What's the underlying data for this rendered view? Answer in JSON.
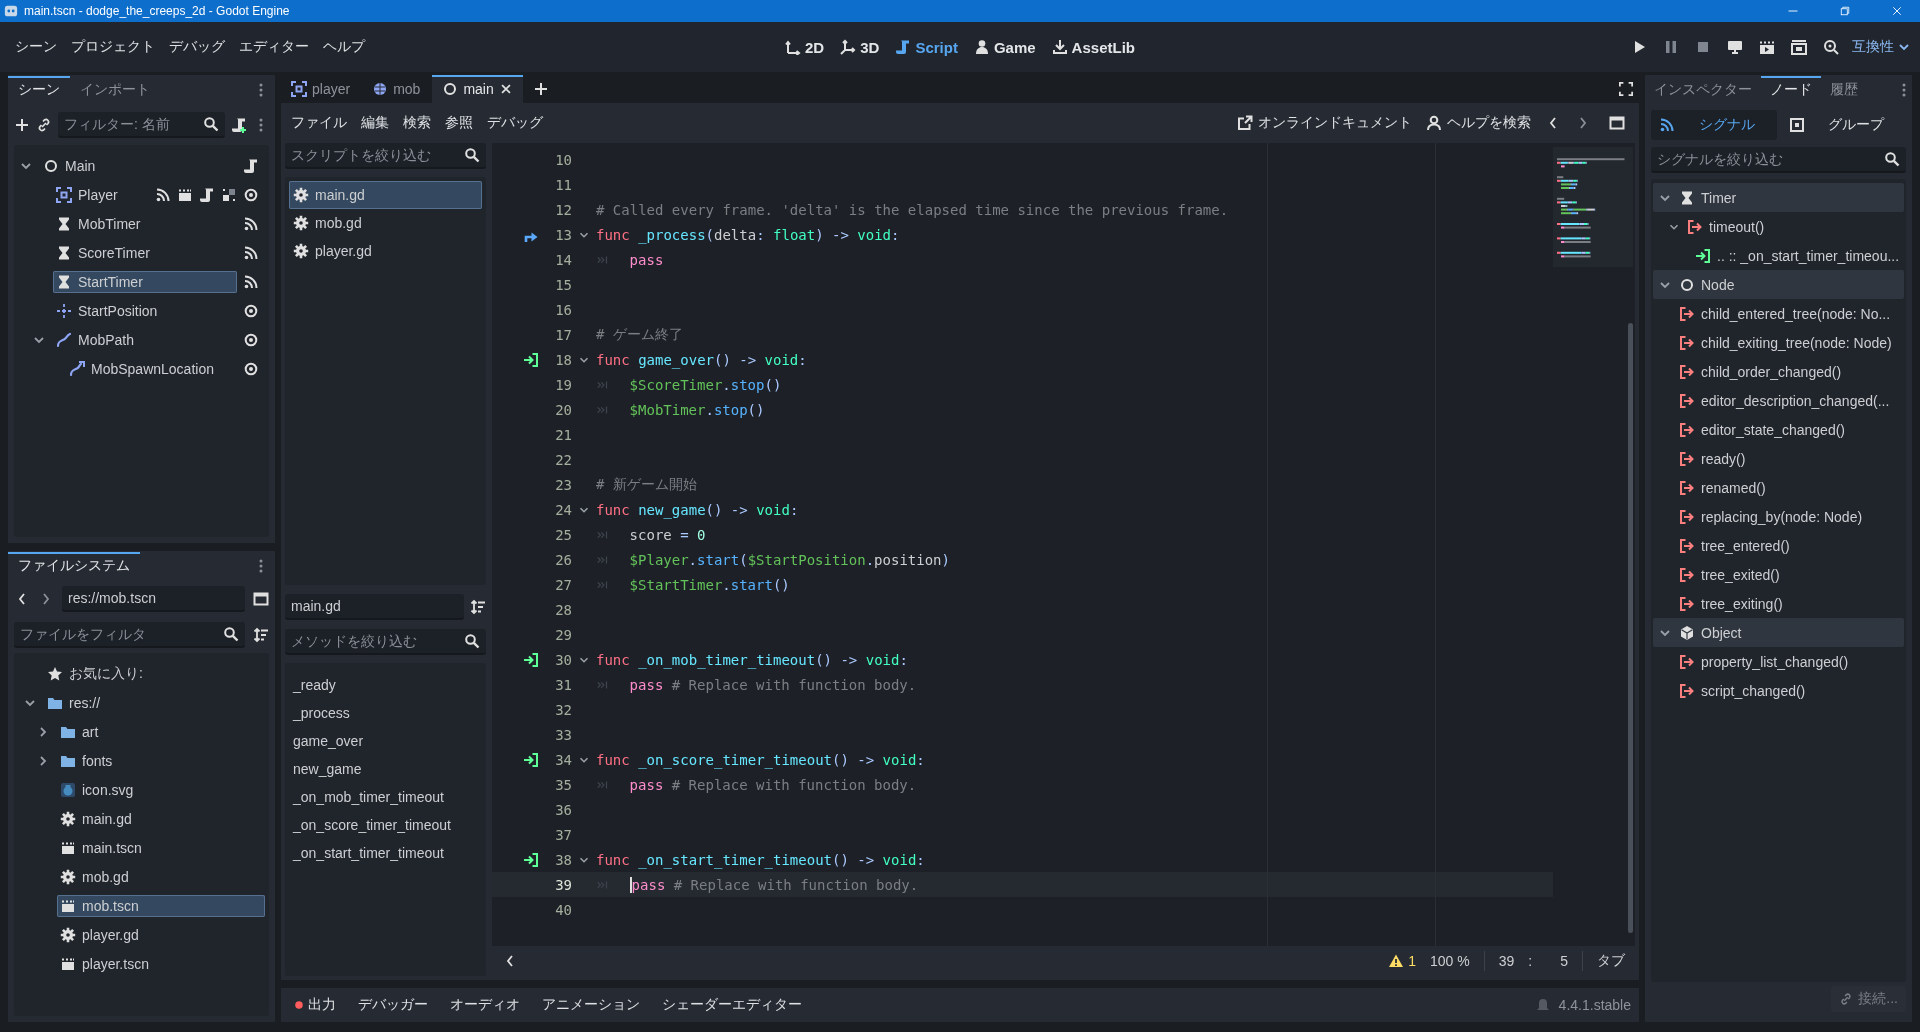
{
  "window": {
    "title": "main.tscn - dodge_the_creeps_2d - Godot Engine"
  },
  "menu": [
    "シーン",
    "プロジェクト",
    "デバッグ",
    "エディター",
    "ヘルプ"
  ],
  "workspaces": [
    {
      "label": "2D",
      "kind": "plane",
      "selected": false
    },
    {
      "label": "3D",
      "kind": "solid",
      "selected": false
    },
    {
      "label": "Script",
      "kind": "script",
      "selected": true
    },
    {
      "label": "Game",
      "kind": "game",
      "selected": false
    },
    {
      "label": "AssetLib",
      "kind": "assetlib",
      "selected": false
    }
  ],
  "renderer": {
    "label": "互換性"
  },
  "scene_dock": {
    "tabs": [
      {
        "label": "シーン",
        "selected": true
      },
      {
        "label": "インポート",
        "selected": false
      }
    ],
    "filter": {
      "placeholder": "フィルター: 名前"
    },
    "tree": [
      {
        "name": "Main",
        "kind": "node",
        "badges": [
          {
            "kind": "script"
          }
        ],
        "selected": false,
        "expanded": true,
        "children": [
          {
            "name": "Player",
            "kind": "area",
            "badges": [
              {
                "kind": "signal"
              },
              {
                "kind": "scene"
              },
              {
                "kind": "script"
              },
              {
                "kind": "group"
              },
              {
                "kind": "visible"
              }
            ],
            "selected": false
          },
          {
            "name": "MobTimer",
            "kind": "timer",
            "badges": [
              {
                "kind": "signal"
              }
            ],
            "selected": false
          },
          {
            "name": "ScoreTimer",
            "kind": "timer",
            "badges": [
              {
                "kind": "signal"
              }
            ],
            "selected": false
          },
          {
            "name": "StartTimer",
            "kind": "timer",
            "badges": [
              {
                "kind": "signal"
              }
            ],
            "selected": true
          },
          {
            "name": "StartPosition",
            "kind": "marker",
            "badges": [
              {
                "kind": "visible"
              }
            ],
            "selected": false
          },
          {
            "name": "MobPath",
            "kind": "path",
            "badges": [
              {
                "kind": "visible"
              }
            ],
            "selected": false,
            "expanded": true,
            "children": [
              {
                "name": "MobSpawnLocation",
                "kind": "pathfollow",
                "badges": [
                  {
                    "kind": "visible"
                  }
                ],
                "selected": false
              }
            ]
          }
        ]
      }
    ]
  },
  "filesystem_dock": {
    "tabs": [
      {
        "label": "ファイルシステム",
        "selected": true
      }
    ],
    "path": "res://mob.tscn",
    "filter": {
      "placeholder": "ファイルをフィルタ"
    },
    "tree": [
      {
        "name": "お気に入り:",
        "kind": "star",
        "selected": false
      },
      {
        "name": "res://",
        "kind": "folder",
        "selected": false,
        "expanded": true,
        "children": [
          {
            "name": "art",
            "kind": "folder",
            "selected": false,
            "expanded": false
          },
          {
            "name": "fonts",
            "kind": "folder",
            "selected": false,
            "expanded": false
          },
          {
            "name": "icon.svg",
            "kind": "image",
            "selected": false
          },
          {
            "name": "main.gd",
            "kind": "gear",
            "selected": false
          },
          {
            "name": "main.tscn",
            "kind": "scene",
            "selected": false
          },
          {
            "name": "mob.gd",
            "kind": "gear",
            "selected": false
          },
          {
            "name": "mob.tscn",
            "kind": "scene",
            "selected": true
          },
          {
            "name": "player.gd",
            "kind": "gear",
            "selected": false
          },
          {
            "name": "player.tscn",
            "kind": "scene",
            "selected": false
          }
        ]
      }
    ]
  },
  "editor_tabs": [
    {
      "label": "player",
      "kind": "area",
      "selected": false
    },
    {
      "label": "mob",
      "kind": "body",
      "selected": false
    },
    {
      "label": "main",
      "kind": "node",
      "selected": true
    }
  ],
  "script_menu": [
    "ファイル",
    "編集",
    "検索",
    "参照",
    "デバッグ"
  ],
  "help_links": [
    "オンラインドキュメント",
    "ヘルプを検索"
  ],
  "scripts_panel": {
    "filter": {
      "placeholder": "スクリプトを絞り込む"
    },
    "scripts": [
      {
        "name": "main.gd",
        "selected": true
      },
      {
        "name": "mob.gd",
        "selected": false
      },
      {
        "name": "player.gd",
        "selected": false
      }
    ],
    "current": "main.gd",
    "method_filter": {
      "placeholder": "メソッドを絞り込む"
    },
    "methods": [
      "_ready",
      "_process",
      "game_over",
      "new_game",
      "_on_mob_timer_timeout",
      "_on_score_timer_timeout",
      "_on_start_timer_timeout"
    ]
  },
  "code": {
    "lines": [
      {
        "number": "10",
        "fold": false,
        "current": false
      },
      {
        "number": "11",
        "fold": false,
        "current": false
      },
      {
        "number": "12",
        "fold": false,
        "current": false,
        "tokens": [
          {
            "text": "# Called every frame. 'delta' is the elapsed time since the previous frame.",
            "kind": "comment"
          }
        ]
      },
      {
        "number": "13",
        "fold": true,
        "current": false,
        "kind": "override",
        "tokens": [
          {
            "text": "func",
            "kind": "keyword"
          },
          {
            "text": "_process",
            "kind": "function"
          },
          {
            "text": "(",
            "kind": "symbol"
          },
          {
            "text": "delta",
            "kind": "text"
          },
          {
            "text": ":",
            "kind": "symbol"
          },
          {
            "text": "float",
            "kind": "type"
          },
          {
            "text": ") ->",
            "kind": "symbol"
          },
          {
            "text": "void",
            "kind": "type"
          },
          {
            "text": ":",
            "kind": "symbol"
          }
        ]
      },
      {
        "number": "14",
        "fold": false,
        "current": false,
        "tokens": [
          {
            "kind": "tab"
          },
          {
            "text": "pass",
            "kind": "control"
          }
        ]
      },
      {
        "number": "15",
        "fold": false,
        "current": false
      },
      {
        "number": "16",
        "fold": false,
        "current": false
      },
      {
        "number": "17",
        "fold": false,
        "current": false,
        "tokens": [
          {
            "text": "# ゲーム終了",
            "kind": "comment"
          }
        ]
      },
      {
        "number": "18",
        "fold": true,
        "current": false,
        "kind": "connected",
        "tokens": [
          {
            "text": "func",
            "kind": "keyword"
          },
          {
            "text": "game_over",
            "kind": "function"
          },
          {
            "text": "() ->",
            "kind": "symbol"
          },
          {
            "text": "void",
            "kind": "type"
          },
          {
            "text": ":",
            "kind": "symbol"
          }
        ]
      },
      {
        "number": "19",
        "fold": false,
        "current": false,
        "tokens": [
          {
            "kind": "tab"
          },
          {
            "text": "$ScoreTimer",
            "kind": "nodepath"
          },
          {
            "text": ".",
            "kind": "symbol"
          },
          {
            "text": "stop",
            "kind": "call"
          },
          {
            "text": "()",
            "kind": "symbol"
          }
        ]
      },
      {
        "number": "20",
        "fold": false,
        "current": false,
        "tokens": [
          {
            "kind": "tab"
          },
          {
            "text": "$MobTimer",
            "kind": "nodepath"
          },
          {
            "text": ".",
            "kind": "symbol"
          },
          {
            "text": "stop",
            "kind": "call"
          },
          {
            "text": "()",
            "kind": "symbol"
          }
        ]
      },
      {
        "number": "21",
        "fold": false,
        "current": false
      },
      {
        "number": "22",
        "fold": false,
        "current": false
      },
      {
        "number": "23",
        "fold": false,
        "current": false,
        "tokens": [
          {
            "text": "# 新ゲーム開始",
            "kind": "comment"
          }
        ]
      },
      {
        "number": "24",
        "fold": true,
        "current": false,
        "tokens": [
          {
            "text": "func",
            "kind": "keyword"
          },
          {
            "text": "new_game",
            "kind": "function"
          },
          {
            "text": "() ->",
            "kind": "symbol"
          },
          {
            "text": "void",
            "kind": "type"
          },
          {
            "text": ":",
            "kind": "symbol"
          }
        ]
      },
      {
        "number": "25",
        "fold": false,
        "current": false,
        "tokens": [
          {
            "kind": "tab"
          },
          {
            "text": "score",
            "kind": "text"
          },
          {
            "text": "=",
            "kind": "operator"
          },
          {
            "text": "0",
            "kind": "number"
          }
        ]
      },
      {
        "number": "26",
        "fold": false,
        "current": false,
        "tokens": [
          {
            "kind": "tab"
          },
          {
            "text": "$Player",
            "kind": "nodepath"
          },
          {
            "text": ".",
            "kind": "symbol"
          },
          {
            "text": "start",
            "kind": "call"
          },
          {
            "text": "(",
            "kind": "symbol"
          },
          {
            "text": "$StartPosition",
            "kind": "nodepath"
          },
          {
            "text": ".",
            "kind": "symbol"
          },
          {
            "text": "position",
            "kind": "text"
          },
          {
            "text": ")",
            "kind": "symbol"
          }
        ]
      },
      {
        "number": "27",
        "fold": false,
        "current": false,
        "tokens": [
          {
            "kind": "tab"
          },
          {
            "text": "$StartTimer",
            "kind": "nodepath"
          },
          {
            "text": ".",
            "kind": "symbol"
          },
          {
            "text": "start",
            "kind": "call"
          },
          {
            "text": "()",
            "kind": "symbol"
          }
        ]
      },
      {
        "number": "28",
        "fold": false,
        "current": false
      },
      {
        "number": "29",
        "fold": false,
        "current": false
      },
      {
        "number": "30",
        "fold": true,
        "current": false,
        "kind": "connected",
        "tokens": [
          {
            "text": "func",
            "kind": "keyword"
          },
          {
            "text": "_on_mob_timer_timeout",
            "kind": "function"
          },
          {
            "text": "() ->",
            "kind": "symbol"
          },
          {
            "text": "void",
            "kind": "type"
          },
          {
            "text": ":",
            "kind": "symbol"
          }
        ]
      },
      {
        "number": "31",
        "fold": false,
        "current": false,
        "tokens": [
          {
            "kind": "tab"
          },
          {
            "text": "pass",
            "kind": "control"
          },
          {
            "text": "# Replace with function body.",
            "kind": "comment"
          }
        ]
      },
      {
        "number": "32",
        "fold": false,
        "current": false
      },
      {
        "number": "33",
        "fold": false,
        "current": false
      },
      {
        "number": "34",
        "fold": true,
        "current": false,
        "kind": "connected",
        "tokens": [
          {
            "text": "func",
            "kind": "keyword"
          },
          {
            "text": "_on_score_timer_timeout",
            "kind": "function"
          },
          {
            "text": "() ->",
            "kind": "symbol"
          },
          {
            "text": "void",
            "kind": "type"
          },
          {
            "text": ":",
            "kind": "symbol"
          }
        ]
      },
      {
        "number": "35",
        "fold": false,
        "current": false,
        "tokens": [
          {
            "kind": "tab"
          },
          {
            "text": "pass",
            "kind": "control"
          },
          {
            "text": "# Replace with function body.",
            "kind": "comment"
          }
        ]
      },
      {
        "number": "36",
        "fold": false,
        "current": false
      },
      {
        "number": "37",
        "fold": false,
        "current": false
      },
      {
        "number": "38",
        "fold": true,
        "current": false,
        "kind": "connected",
        "tokens": [
          {
            "text": "func",
            "kind": "keyword"
          },
          {
            "text": "_on_start_timer_timeout",
            "kind": "function"
          },
          {
            "text": "() ->",
            "kind": "symbol"
          },
          {
            "text": "void",
            "kind": "type"
          },
          {
            "text": ":",
            "kind": "symbol"
          }
        ]
      },
      {
        "number": "39",
        "fold": false,
        "current": true,
        "tokens": [
          {
            "kind": "tab"
          },
          {
            "text": "pass",
            "kind": "control"
          },
          {
            "text": "# Replace with function body.",
            "kind": "comment"
          }
        ]
      },
      {
        "number": "40",
        "fold": false,
        "current": false
      }
    ]
  },
  "status": {
    "warnings": "1",
    "zoom": "100 %",
    "line": "39",
    "separator": ":",
    "column": "5",
    "indent": "タブ"
  },
  "bottom_panel": {
    "tabs": [
      {
        "label": "出力",
        "alert": true
      },
      {
        "label": "デバッガー",
        "alert": false
      },
      {
        "label": "オーディオ",
        "alert": false
      },
      {
        "label": "アニメーション",
        "alert": false
      },
      {
        "label": "シェーダーエディター",
        "alert": false
      }
    ],
    "version": "4.4.1.stable"
  },
  "node_dock": {
    "tabs": [
      {
        "label": "インスペクター",
        "selected": false
      },
      {
        "label": "ノード",
        "selected": true
      },
      {
        "label": "履歴",
        "selected": false
      }
    ],
    "subtabs": [
      {
        "label": "シグナル",
        "kind": "signal",
        "selected": true
      },
      {
        "label": "グループ",
        "kind": "groups",
        "selected": false
      }
    ],
    "filter": {
      "placeholder": "シグナルを絞り込む"
    },
    "groups": [
      {
        "name": "Timer",
        "kind": "timer",
        "expanded": true,
        "signals": [
          {
            "name": "timeout()",
            "expanded": true,
            "children": [
              {
                "name": ".. :: _on_start_timer_timeou..."
              }
            ]
          }
        ]
      },
      {
        "name": "Node",
        "kind": "node",
        "expanded": true,
        "signals": [
          {
            "name": "child_entered_tree(node: No..."
          },
          {
            "name": "child_exiting_tree(node: Node)"
          },
          {
            "name": "child_order_changed()"
          },
          {
            "name": "editor_description_changed(..."
          },
          {
            "name": "editor_state_changed()"
          },
          {
            "name": "ready()"
          },
          {
            "name": "renamed()"
          },
          {
            "name": "replacing_by(node: Node)"
          },
          {
            "name": "tree_entered()"
          },
          {
            "name": "tree_exited()"
          },
          {
            "name": "tree_exiting()"
          }
        ]
      },
      {
        "name": "Object",
        "kind": "object",
        "expanded": true,
        "signals": [
          {
            "name": "property_list_changed()"
          },
          {
            "name": "script_changed()"
          }
        ]
      }
    ],
    "connect_button": "接続..."
  }
}
